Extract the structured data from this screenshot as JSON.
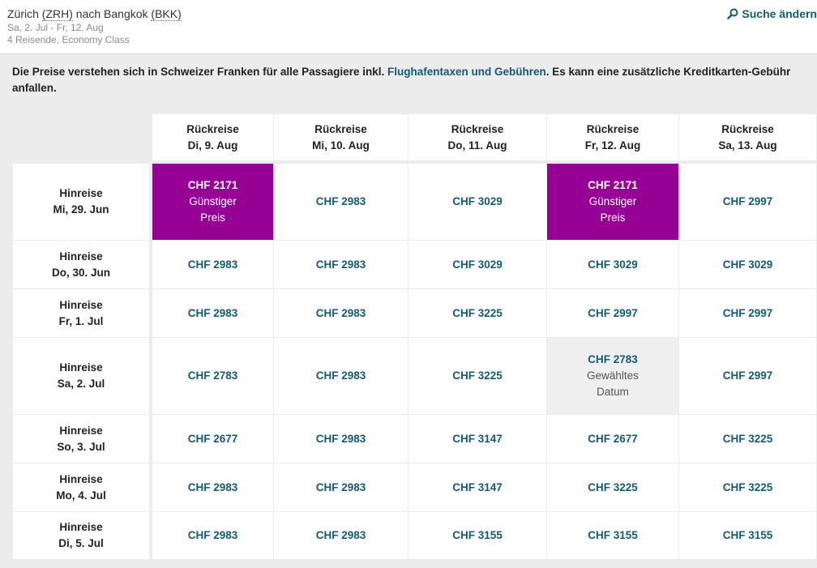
{
  "header": {
    "from_city": "Zürich",
    "from_code": "(ZRH)",
    "connector": "nach",
    "to_city": "Bangkok",
    "to_code": "(BKK)",
    "dates": "Sa, 2. Jul - Fr, 12. Aug",
    "travellers": "4 Reisende, Economy Class",
    "search_label": "Suche ändern"
  },
  "notice": {
    "text_before": "Die Preise verstehen sich in Schweizer Franken für alle Passagiere inkl. ",
    "link_text": "Flughafentaxen und Gebühren",
    "text_after": ". Es kann eine zusätzliche Kreditkarten-Gebühr anfallen."
  },
  "matrix": {
    "return_label": "Rückreise",
    "outbound_label": "Hinreise",
    "cheapest_label_1": "Günstiger",
    "cheapest_label_2": "Preis",
    "selected_label_1": "Gewähltes",
    "selected_label_2": "Datum",
    "return_dates": [
      "Di, 9. Aug",
      "Mi, 10. Aug",
      "Do, 11. Aug",
      "Fr, 12. Aug",
      "Sa, 13. Aug"
    ],
    "rows": [
      {
        "date": "Mi, 29. Jun",
        "prices": [
          "CHF 2171",
          "CHF 2983",
          "CHF 3029",
          "CHF 2171",
          "CHF 2997"
        ],
        "states": [
          "cheap",
          "",
          "",
          "cheap",
          ""
        ]
      },
      {
        "date": "Do, 30. Jun",
        "prices": [
          "CHF 2983",
          "CHF 2983",
          "CHF 3029",
          "CHF 3029",
          "CHF 3029"
        ],
        "states": [
          "",
          "",
          "",
          "",
          ""
        ]
      },
      {
        "date": "Fr, 1. Jul",
        "prices": [
          "CHF 2983",
          "CHF 2983",
          "CHF 3225",
          "CHF 2997",
          "CHF 2997"
        ],
        "states": [
          "",
          "",
          "",
          "",
          ""
        ]
      },
      {
        "date": "Sa, 2. Jul",
        "prices": [
          "CHF 2783",
          "CHF 2983",
          "CHF 3225",
          "CHF 2783",
          "CHF 2997"
        ],
        "states": [
          "",
          "",
          "",
          "selected",
          ""
        ]
      },
      {
        "date": "So, 3. Jul",
        "prices": [
          "CHF 2677",
          "CHF 2983",
          "CHF 3147",
          "CHF 2677",
          "CHF 3225"
        ],
        "states": [
          "",
          "",
          "",
          "",
          ""
        ]
      },
      {
        "date": "Mo, 4. Jul",
        "prices": [
          "CHF 2983",
          "CHF 2983",
          "CHF 3147",
          "CHF 3225",
          "CHF 3225"
        ],
        "states": [
          "",
          "",
          "",
          "",
          ""
        ]
      },
      {
        "date": "Di, 5. Jul",
        "prices": [
          "CHF 2983",
          "CHF 2983",
          "CHF 3155",
          "CHF 3155",
          "CHF 3155"
        ],
        "states": [
          "",
          "",
          "",
          "",
          ""
        ]
      }
    ]
  },
  "colors": {
    "cheapest": "#960095",
    "link": "#145a72",
    "selected": "#efefef"
  }
}
